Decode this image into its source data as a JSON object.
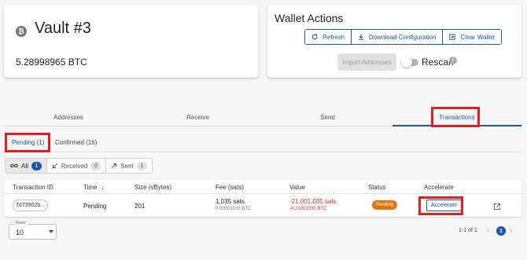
{
  "vault": {
    "title": "Vault #3",
    "balance": "5.28998965 BTC",
    "icon": "bitcoin-icon"
  },
  "wallet_actions": {
    "title": "Wallet Actions",
    "refresh_label": "Refresh",
    "download_label": "Download Configuration",
    "clear_label": "Clear Wallet",
    "import_label": "Import Addresses",
    "rescan_label": "Rescan",
    "rescan_enabled": false
  },
  "main_tabs": {
    "addresses": "Addresses",
    "receive": "Receive",
    "send": "Send",
    "transactions": "Transactions",
    "active": "Transactions"
  },
  "sub_tabs": {
    "pending": "Pending (1)",
    "confirmed": "Confirmed (16)",
    "active": "Pending (1)"
  },
  "filters": {
    "all_label": "All",
    "all_count": "1",
    "received_label": "Received",
    "received_count": "0",
    "sent_label": "Sent",
    "sent_count": "1"
  },
  "table": {
    "headers": {
      "txid": "Transaction ID",
      "time": "Time",
      "size": "Size (vBytes)",
      "fee": "Fee (sats)",
      "value": "Value",
      "status": "Status",
      "accelerate": "Accelerate"
    },
    "rows": [
      {
        "txid": "7d73902b...",
        "time": "Pending",
        "size": "201",
        "fee_sats": "1,035 sats",
        "fee_btc": "0.00001035 BTC",
        "value_sats": "-21,001,035 sats",
        "value_btc": "-0.21001035 BTC",
        "status": "Pending",
        "accelerate_label": "Accelerate"
      }
    ]
  },
  "pagination": {
    "rows_label": "Rows",
    "rows_value": "10",
    "range_text": "1-1 of 1",
    "current_page": "1"
  },
  "colors": {
    "accent": "#1a57b0",
    "pending_badge": "#e8730c",
    "negative_value": "#d32f2f",
    "highlight_box": "#e02020"
  }
}
